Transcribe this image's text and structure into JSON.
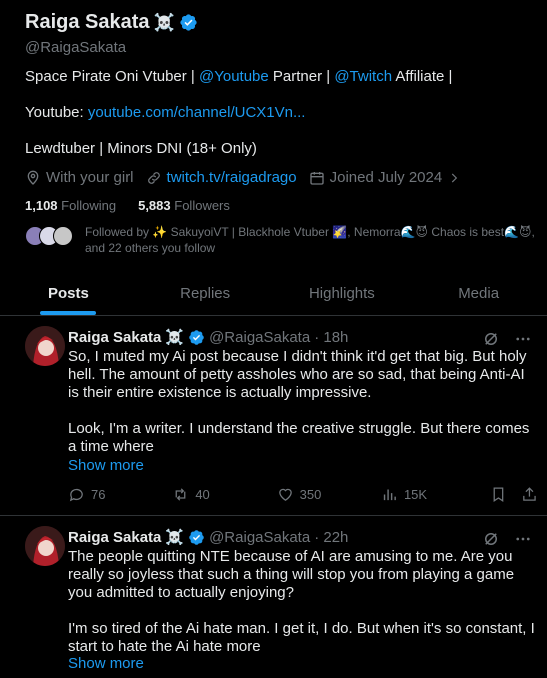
{
  "profile": {
    "display_name": "Raiga Sakata",
    "name_emoji": "☠️",
    "handle": "@RaigaSakata",
    "bio_line1_a": "Space Pirate Oni Vtuber | ",
    "bio_link_youtube": "@Youtube",
    "bio_line1_b": " Partner | ",
    "bio_link_twitch": "@Twitch",
    "bio_line1_c": " Affiliate |",
    "bio_line2_label": "Youtube: ",
    "bio_line2_link": "youtube.com/channel/UCX1Vn...",
    "bio_line3": "Lewdtuber | Minors DNI (18+ Only)",
    "location": "With your girl",
    "website": "twitch.tv/raigadrago",
    "joined": "Joined July 2024",
    "following_count": "1,108",
    "following_label": "Following",
    "followers_count": "5,883",
    "followers_label": "Followers",
    "followed_by": "Followed by ✨ SakuyoiVT | Blackhole Vtuber 🌠, Nemorra🌊😈 Chaos is best🌊😈, and 22 others you follow"
  },
  "tabs": [
    "Posts",
    "Replies",
    "Highlights",
    "Media"
  ],
  "tweets": [
    {
      "name": "Raiga Sakata",
      "emoji": "☠️",
      "handle": "@RaigaSakata",
      "time": "· 18h",
      "text": "So, I muted my Ai post because I didn't think it'd get that big. But holy hell. The amount of petty assholes who are so sad, that being Anti-AI is their entire existence is actually impressive.\n\nLook, I'm a writer. I understand the creative struggle. But there comes a time where",
      "show_more": "Show more",
      "replies": "76",
      "reposts": "40",
      "likes": "350",
      "views": "15K"
    },
    {
      "name": "Raiga Sakata",
      "emoji": "☠️",
      "handle": "@RaigaSakata",
      "time": "· 22h",
      "text": "The people quitting NTE because of AI are amusing to me. Are you really so joyless that such a thing will stop you from playing a game you admitted to actually enjoying?\n\nI'm so tired of the Ai hate man. I get it, I do. But when it's so constant, I start to hate the Ai hate more",
      "show_more": "Show more"
    }
  ],
  "colors": {
    "accent": "#1d9bf0",
    "muted": "#71767b",
    "text": "#e7e9ea",
    "border": "#2f3336"
  }
}
